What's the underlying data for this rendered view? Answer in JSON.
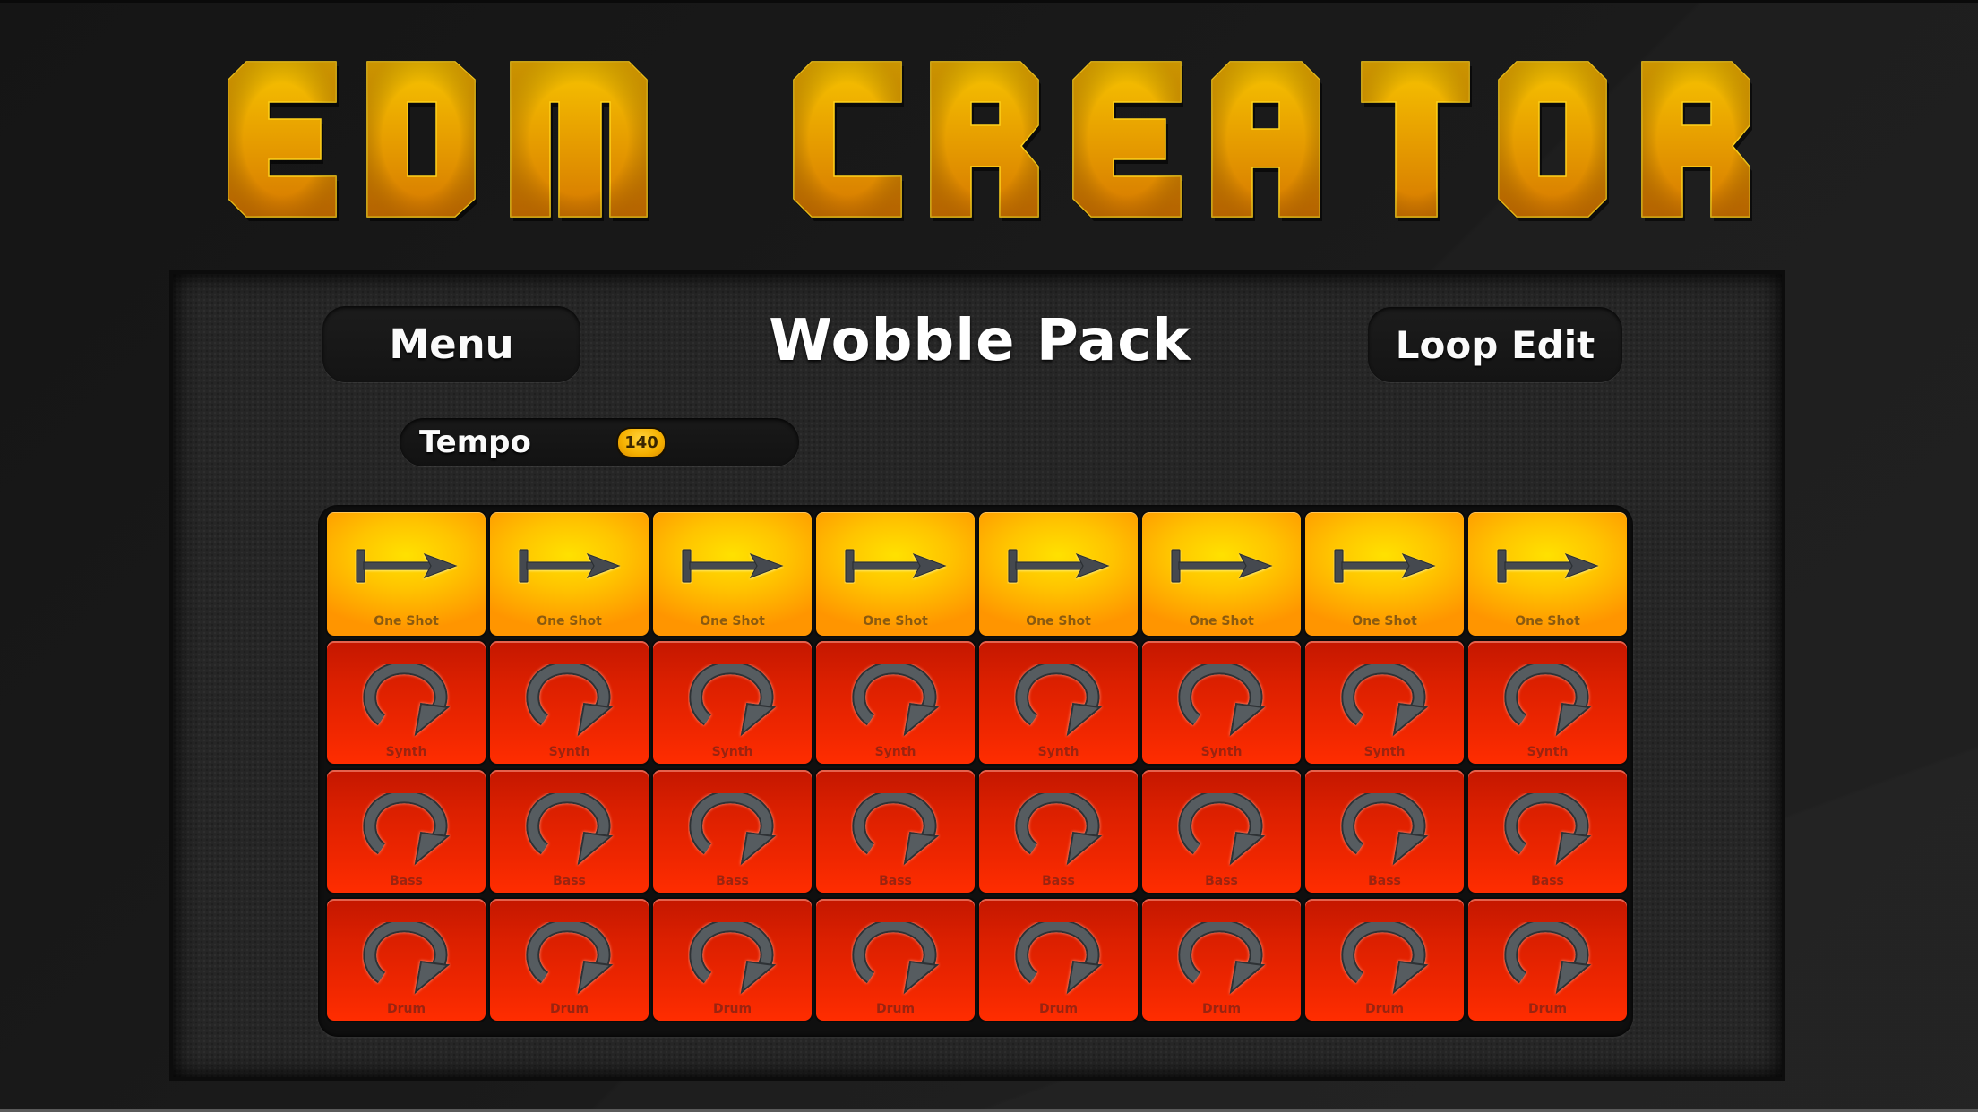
{
  "app": {
    "logo_text": "EDM CREATOR",
    "colors": {
      "logo_top": "#f7c400",
      "logo_bottom": "#d67800",
      "pad_oneshot": "#ffc400",
      "pad_loop": "#ee2600",
      "panel": "#262626"
    }
  },
  "header": {
    "menu_label": "Menu",
    "pack_title": "Wobble Pack",
    "loop_edit_label": "Loop Edit"
  },
  "tempo": {
    "label": "Tempo",
    "value": "140"
  },
  "grid": {
    "columns": 8,
    "rows": [
      {
        "type": "oneshot",
        "label": "One Shot",
        "icon": "one-shot-arrow-icon"
      },
      {
        "type": "loop",
        "label": "Synth",
        "icon": "loop-arrow-icon"
      },
      {
        "type": "loop",
        "label": "Bass",
        "icon": "loop-arrow-icon"
      },
      {
        "type": "loop",
        "label": "Drum",
        "icon": "loop-arrow-icon"
      }
    ]
  }
}
